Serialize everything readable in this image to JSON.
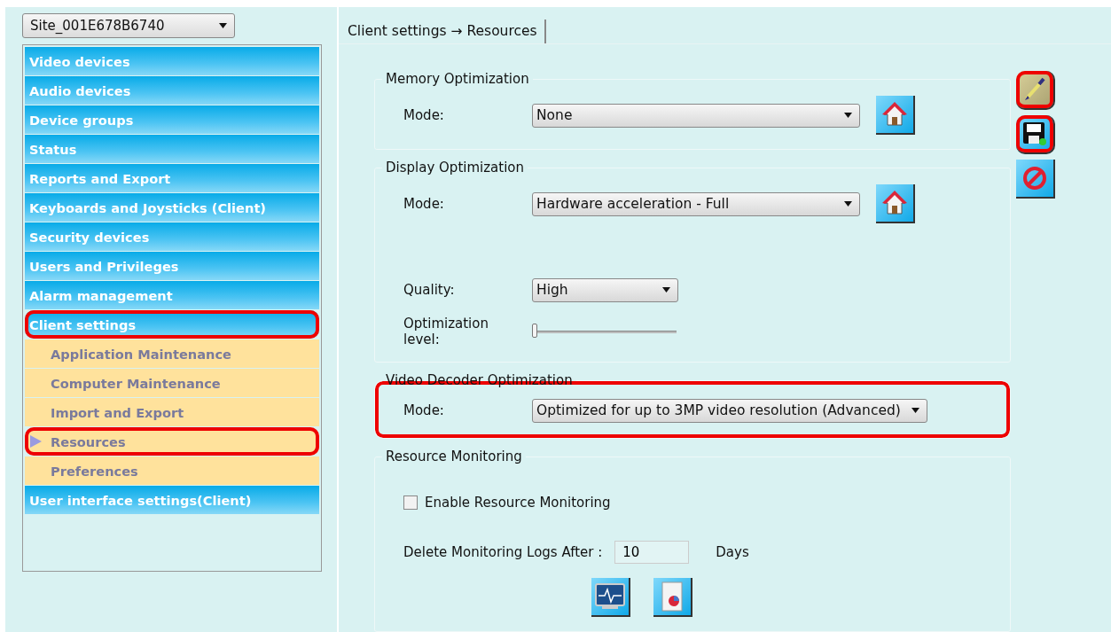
{
  "site_selector": {
    "value": "Site_001E678B6740"
  },
  "nav": [
    {
      "label": "Video devices",
      "highlighted": false
    },
    {
      "label": "Audio devices",
      "highlighted": false
    },
    {
      "label": "Device groups",
      "highlighted": false
    },
    {
      "label": "Status",
      "highlighted": false
    },
    {
      "label": "Reports and Export",
      "highlighted": false
    },
    {
      "label": "Keyboards and Joysticks (Client)",
      "highlighted": false
    },
    {
      "label": "Security devices",
      "highlighted": false
    },
    {
      "label": "Users and Privileges",
      "highlighted": false
    },
    {
      "label": "Alarm management",
      "highlighted": false
    },
    {
      "label": "Client settings",
      "highlighted": true,
      "children": [
        {
          "label": "Application Maintenance",
          "selected": false,
          "highlighted": false
        },
        {
          "label": "Computer Maintenance",
          "selected": false,
          "highlighted": false
        },
        {
          "label": "Import and Export",
          "selected": false,
          "highlighted": false
        },
        {
          "label": "Resources",
          "selected": true,
          "highlighted": true
        },
        {
          "label": "Preferences",
          "selected": false,
          "highlighted": false
        }
      ]
    },
    {
      "label": "User interface settings(Client)",
      "highlighted": false
    }
  ],
  "tab": {
    "label": "Client settings → Resources",
    "selected": true
  },
  "groups": [
    {
      "title": "Memory Optimization",
      "highlighted": false,
      "rows": [
        {
          "kind": "select",
          "label": "Mode:",
          "value": "None",
          "default_button": true
        }
      ]
    },
    {
      "title": "Display Optimization",
      "highlighted": false,
      "rows": [
        {
          "kind": "select",
          "label": "Mode:",
          "value": "Hardware acceleration - Full",
          "default_button": true
        },
        {
          "kind": "select",
          "label": "Quality:",
          "value": "High"
        },
        {
          "kind": "slider",
          "label": "Optimization level:",
          "level": 0
        }
      ]
    },
    {
      "title": "Video Decoder Optimization",
      "highlighted": true,
      "rows": [
        {
          "kind": "select",
          "label": "Mode:",
          "value": "Optimized for up to 3MP video resolution (Advanced)"
        }
      ]
    },
    {
      "title": "Resource Monitoring",
      "highlighted": false,
      "rows": [
        {
          "kind": "checkbox",
          "label": "Enable Resource Monitoring",
          "checked": false
        },
        {
          "kind": "number",
          "label": "Delete Monitoring Logs After :",
          "value": "10",
          "unit": "Days"
        },
        {
          "kind": "icons",
          "buttons": [
            {
              "kind": "monitor"
            },
            {
              "kind": "report"
            }
          ]
        }
      ]
    }
  ],
  "actions": [
    {
      "kind": "edit",
      "highlighted": true
    },
    {
      "kind": "save",
      "highlighted": true
    },
    {
      "kind": "cancel",
      "highlighted": false
    }
  ]
}
